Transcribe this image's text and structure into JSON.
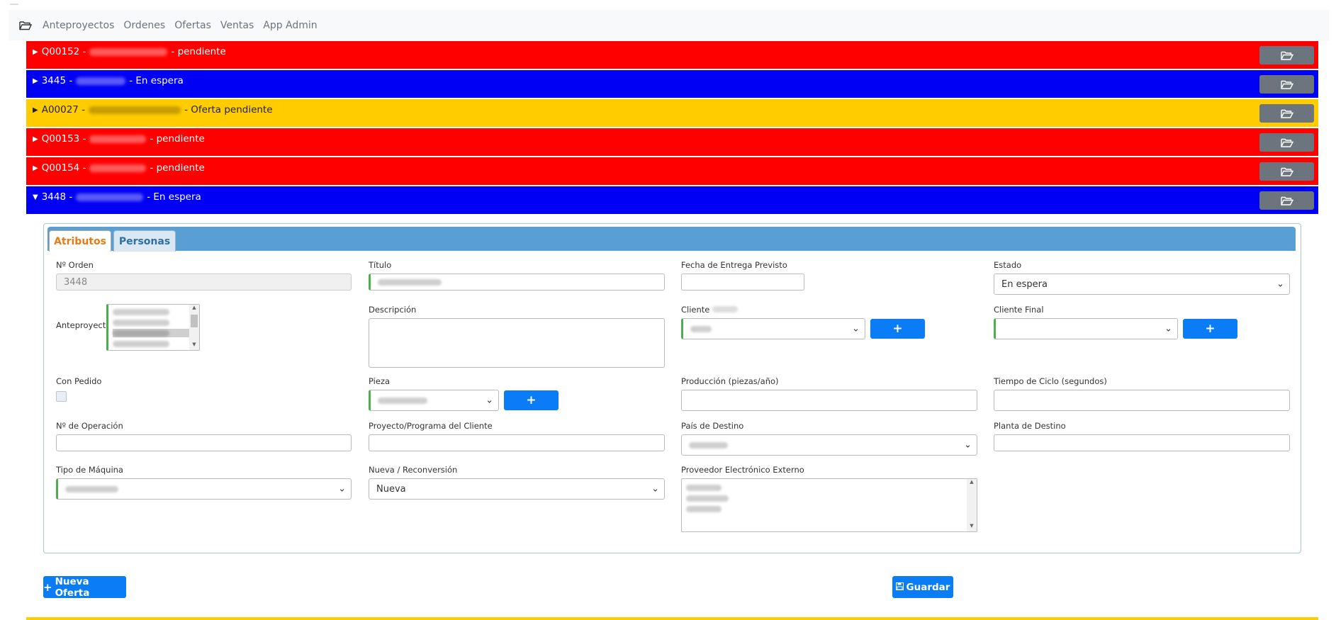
{
  "nav": {
    "items": [
      "Anteproyectos",
      "Ordenes",
      "Ofertas",
      "Ventas",
      "App Admin"
    ]
  },
  "rows": [
    {
      "code": "Q00152",
      "sep": "-",
      "status": "- pendiente",
      "color": "#ff0000"
    },
    {
      "code": "3445",
      "sep": "-",
      "status": "- En espera",
      "color": "#0000f5"
    },
    {
      "code": "A00027",
      "sep": "-",
      "status": "- Oferta pendiente",
      "color": "#ffcc00"
    },
    {
      "code": "Q00153",
      "sep": "-",
      "status": "- pendiente",
      "color": "#ff0000"
    },
    {
      "code": "Q00154",
      "sep": "-",
      "status": "- pendiente",
      "color": "#ff0000"
    },
    {
      "code": "3448",
      "sep": "-",
      "status": "- En espera",
      "color": "#0000f5"
    }
  ],
  "tabs": {
    "attributes": "Atributos",
    "people": "Personas"
  },
  "form": {
    "order_no": {
      "label": "Nº Orden",
      "value": "3448"
    },
    "title": {
      "label": "Título"
    },
    "delivery_date": {
      "label": "Fecha de Entrega Previsto",
      "value": ""
    },
    "status": {
      "label": "Estado",
      "value": "En espera"
    },
    "preprojects": {
      "label": "Anteproyectos"
    },
    "description": {
      "label": "Descripción"
    },
    "client": {
      "label": "Cliente"
    },
    "final_client": {
      "label": "Cliente Final"
    },
    "with_order": {
      "label": "Con Pedido"
    },
    "part": {
      "label": "Pieza"
    },
    "production": {
      "label": "Producción (piezas/año)"
    },
    "cycle_time": {
      "label": "Tiempo de Ciclo (segundos)"
    },
    "operation_no": {
      "label": "Nº de Operación"
    },
    "client_project": {
      "label": "Proyecto/Programa del Cliente"
    },
    "destination_country": {
      "label": "País de Destino"
    },
    "destination_plant": {
      "label": "Planta de Destino"
    },
    "machine_type": {
      "label": "Tipo de Máquina"
    },
    "new_reconversion": {
      "label": "Nueva / Reconversión",
      "value": "Nueva"
    },
    "external_supplier": {
      "label": "Proveedor Electrónico Externo"
    }
  },
  "buttons": {
    "new_offer": "Nueva Oferta",
    "save": "Guardar"
  },
  "icons": {
    "folder": "folder-open-icon",
    "plus": "plus-icon",
    "save": "floppy-icon"
  },
  "colors": {
    "red": "#ff0000",
    "blue": "#0000f5",
    "yellow": "#ffcc00",
    "primary": "#0a7cf5",
    "folder_btn": "#6c757d"
  }
}
